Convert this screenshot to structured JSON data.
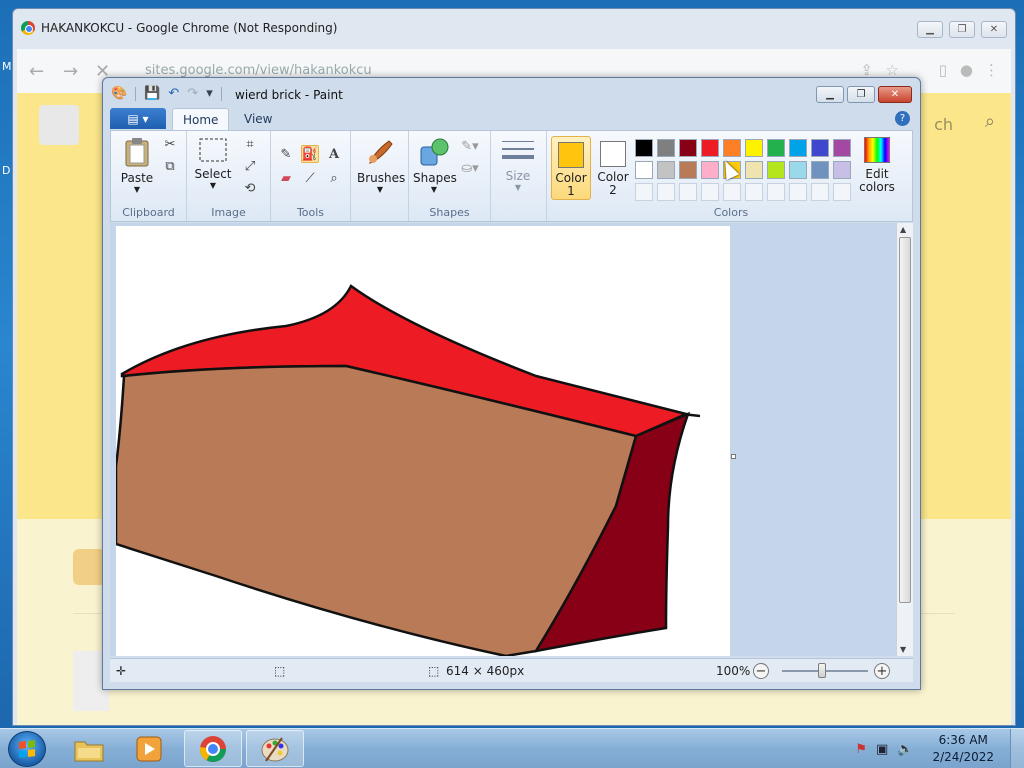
{
  "chrome": {
    "title": "HAKANKOKCU - Google Chrome (Not Responding)",
    "url": "sites.google.com/view/hakankokcu",
    "search_placeholder": "Search",
    "search_partial": "ch"
  },
  "paint": {
    "title": "wierd brick - Paint",
    "tabs": {
      "home": "Home",
      "view": "View"
    },
    "groups": {
      "clipboard": "Clipboard",
      "image": "Image",
      "tools": "Tools",
      "shapes": "Shapes",
      "colors": "Colors"
    },
    "buttons": {
      "paste": "Paste",
      "select": "Select",
      "brushes": "Brushes",
      "shapes": "Shapes",
      "size": "Size",
      "color1_line1": "Color",
      "color1_line2": "1",
      "color2_line1": "Color",
      "color2_line2": "2",
      "edit_colors_line1": "Edit",
      "edit_colors_line2": "colors"
    },
    "color1": "#ffc40e",
    "color2": "#ffffff",
    "palette": [
      "#000000",
      "#7f7f7f",
      "#880015",
      "#ed1c24",
      "#ff7f27",
      "#fff200",
      "#22b14c",
      "#00a2e8",
      "#3f48cc",
      "#a349a4",
      "#ffffff",
      "#c3c3c3",
      "#b97a57",
      "#ffaec9",
      "#ffc90e",
      "#efe4b0",
      "#b5e61d",
      "#99d9ea",
      "#7092be",
      "#c8bfe7"
    ],
    "status": {
      "dimensions": "614 × 460px",
      "zoom": "100%"
    }
  },
  "drawing": {
    "top_color": "#ed1c24",
    "front_color": "#b97a57",
    "side_color": "#880015"
  },
  "taskbar": {
    "time": "6:36 AM",
    "date": "2/24/2022"
  },
  "desktop": {
    "letter_1": "M",
    "letter_2": "D"
  }
}
